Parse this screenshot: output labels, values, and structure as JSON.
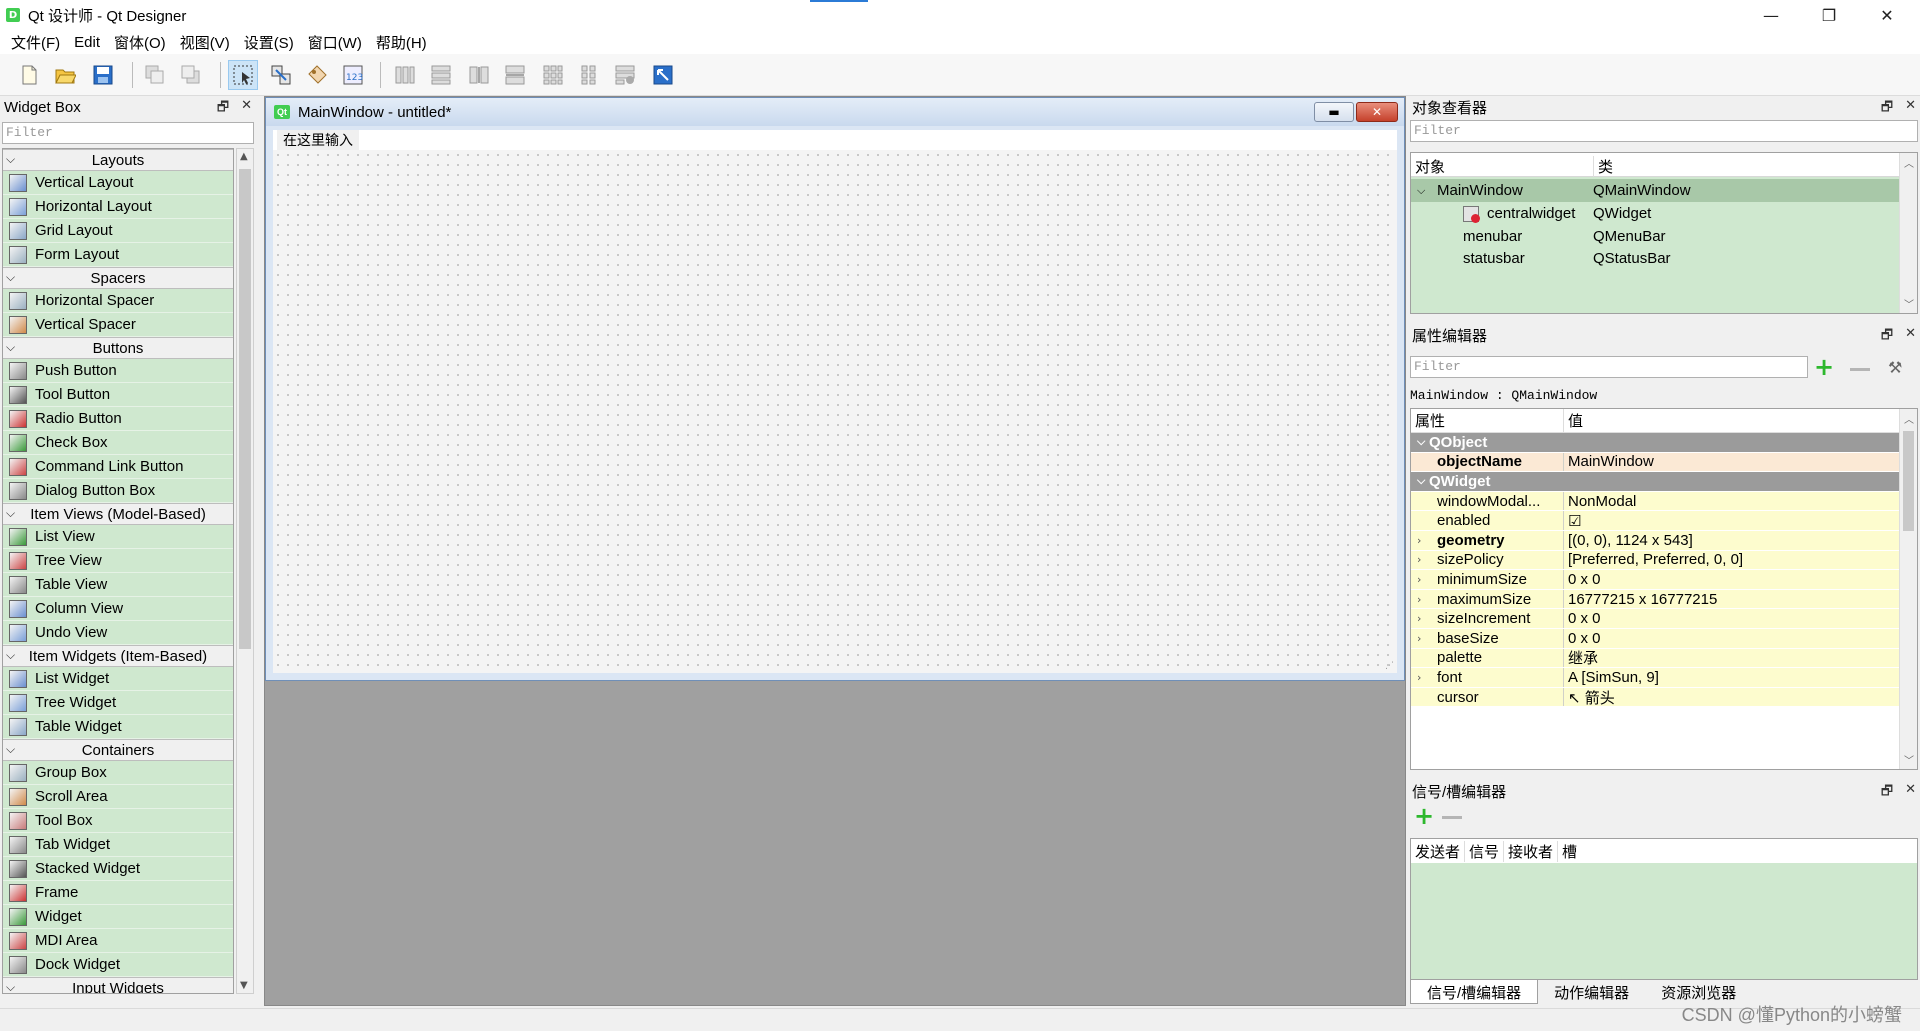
{
  "window": {
    "title": "Qt 设计师 - Qt Designer",
    "icon": "D",
    "minimize": "—",
    "maximize": "❐",
    "close": "✕"
  },
  "menubar": [
    "文件(F)",
    "Edit",
    "窗体(O)",
    "视图(V)",
    "设置(S)",
    "窗口(W)",
    "帮助(H)"
  ],
  "toolbar": {
    "buttons": [
      "new-file-icon",
      "open-file-icon",
      "save-icon",
      "send-to-back-icon",
      "bring-to-front-icon",
      "edit-widgets-icon",
      "edit-signals-slots-icon",
      "edit-buddies-icon",
      "edit-tab-order-icon",
      "layout-horizontal-icon",
      "layout-vertical-icon",
      "layout-horizontal-splitter-icon",
      "layout-vertical-splitter-icon",
      "layout-grid-icon",
      "layout-form-icon",
      "break-layout-icon",
      "adjust-size-icon"
    ]
  },
  "widget_box": {
    "title": "Widget Box",
    "filter_placeholder": "Filter",
    "float_btn": "🗗",
    "close_btn": "✕",
    "categories": [
      {
        "name": "Layouts",
        "items": [
          "Vertical Layout",
          "Horizontal Layout",
          "Grid Layout",
          "Form Layout"
        ]
      },
      {
        "name": "Spacers",
        "items": [
          "Horizontal Spacer",
          "Vertical Spacer"
        ]
      },
      {
        "name": "Buttons",
        "items": [
          "Push Button",
          "Tool Button",
          "Radio Button",
          "Check Box",
          "Command Link Button",
          "Dialog Button Box"
        ]
      },
      {
        "name": "Item Views (Model-Based)",
        "items": [
          "List View",
          "Tree View",
          "Table View",
          "Column View",
          "Undo View"
        ]
      },
      {
        "name": "Item Widgets (Item-Based)",
        "items": [
          "List Widget",
          "Tree Widget",
          "Table Widget"
        ]
      },
      {
        "name": "Containers",
        "items": [
          "Group Box",
          "Scroll Area",
          "Tool Box",
          "Tab Widget",
          "Stacked Widget",
          "Frame",
          "Widget",
          "MDI Area",
          "Dock Widget"
        ]
      },
      {
        "name": "Input Widgets",
        "items": []
      }
    ]
  },
  "form_window": {
    "title": "MainWindow - untitled*",
    "icon": "Qt",
    "menu_placeholder": "在这里输入"
  },
  "object_inspector": {
    "title": "对象查看器",
    "filter_placeholder": "Filter",
    "col_object": "对象",
    "col_class": "类",
    "rows": [
      {
        "object": "MainWindow",
        "class": "QMainWindow"
      },
      {
        "object": "centralwidget",
        "class": "QWidget"
      },
      {
        "object": "menubar",
        "class": "QMenuBar"
      },
      {
        "object": "statusbar",
        "class": "QStatusBar"
      }
    ]
  },
  "property_editor": {
    "title": "属性编辑器",
    "filter_placeholder": "Filter",
    "object_label": "MainWindow : QMainWindow",
    "col_property": "属性",
    "col_value": "值",
    "rows": [
      {
        "name": "QObject",
        "value": "",
        "kind": "group"
      },
      {
        "name": "objectName",
        "value": "MainWindow",
        "kind": "obj"
      },
      {
        "name": "QWidget",
        "value": "",
        "kind": "group"
      },
      {
        "name": "windowModal...",
        "value": "NonModal",
        "kind": "plain"
      },
      {
        "name": "enabled",
        "value": "☑",
        "kind": "plain"
      },
      {
        "name": "geometry",
        "value": "[(0, 0), 1124 x 543]",
        "kind": "bold"
      },
      {
        "name": "sizePolicy",
        "value": "[Preferred, Preferred, 0, 0]",
        "kind": "expand"
      },
      {
        "name": "minimumSize",
        "value": "0 x 0",
        "kind": "expand"
      },
      {
        "name": "maximumSize",
        "value": "16777215 x 16777215",
        "kind": "expand"
      },
      {
        "name": "sizeIncrement",
        "value": "0 x 0",
        "kind": "expand"
      },
      {
        "name": "baseSize",
        "value": "0 x 0",
        "kind": "expand"
      },
      {
        "name": "palette",
        "value": "继承",
        "kind": "plain"
      },
      {
        "name": "font",
        "value": "A  [SimSun, 9]",
        "kind": "expand"
      },
      {
        "name": "cursor",
        "value": "↖  箭头",
        "kind": "plain"
      }
    ]
  },
  "signal_slot_editor": {
    "title": "信号/槽编辑器",
    "columns": [
      "发送者",
      "信号",
      "接收者",
      "槽"
    ],
    "tabs": [
      "信号/槽编辑器",
      "动作编辑器",
      "资源浏览器"
    ]
  },
  "watermark": "CSDN @懂Python的小螃蟹",
  "colors": {
    "green_row": "#cfe8cf",
    "group_row": "#9b9b9b",
    "yellow_row": "#fdfcce",
    "object_row": "#fbe9d5",
    "mdi_bg": "#a0a0a0"
  }
}
